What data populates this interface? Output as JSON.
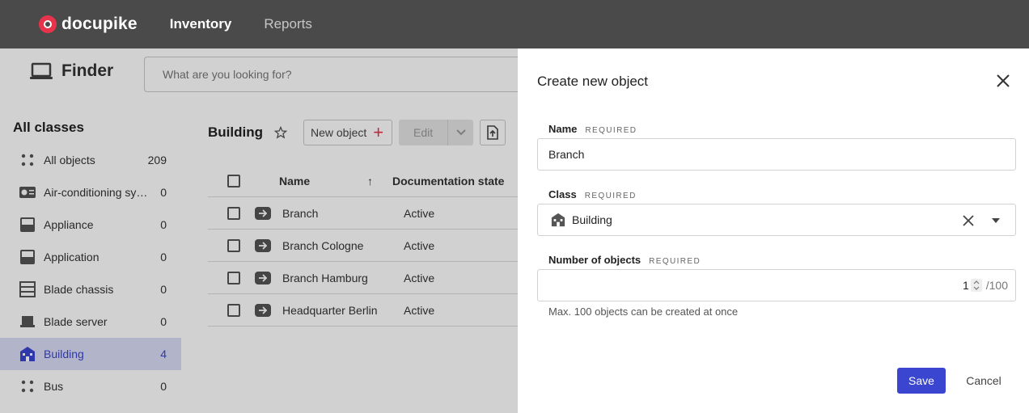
{
  "topbar": {
    "brand": "docupike",
    "nav": [
      {
        "label": "Inventory",
        "active": true
      },
      {
        "label": "Reports",
        "active": false
      }
    ]
  },
  "finder": {
    "title": "Finder",
    "search_placeholder": "What are you looking for?"
  },
  "sidebar": {
    "title": "All classes",
    "items": [
      {
        "label": "All objects",
        "count": "209",
        "icon": "dots-grid-icon"
      },
      {
        "label": "Air-conditioning system",
        "count": "0",
        "icon": "ac-unit-icon"
      },
      {
        "label": "Appliance",
        "count": "0",
        "icon": "appliance-icon"
      },
      {
        "label": "Application",
        "count": "0",
        "icon": "application-icon"
      },
      {
        "label": "Blade chassis",
        "count": "0",
        "icon": "blade-chassis-icon"
      },
      {
        "label": "Blade server",
        "count": "0",
        "icon": "blade-server-icon"
      },
      {
        "label": "Building",
        "count": "4",
        "icon": "building-icon",
        "selected": true
      },
      {
        "label": "Bus",
        "count": "0",
        "icon": "dots-grid-icon"
      }
    ]
  },
  "content": {
    "class_title": "Building",
    "new_object_label": "New object",
    "edit_label": "Edit",
    "table": {
      "headers": {
        "name": "Name",
        "state": "Documentation state"
      },
      "rows": [
        {
          "name": "Branch",
          "state": "Active"
        },
        {
          "name": "Branch Cologne",
          "state": "Active"
        },
        {
          "name": "Branch Hamburg",
          "state": "Active"
        },
        {
          "name": "Headquarter Berlin",
          "state": "Active"
        }
      ]
    }
  },
  "drawer": {
    "title": "Create new object",
    "required_tag": "REQUIRED",
    "name_label": "Name",
    "name_value": "Branch",
    "class_label": "Class",
    "class_value": "Building",
    "count_label": "Number of objects",
    "count_value": "1",
    "count_max": "/100",
    "hint": "Max. 100 objects can be created at once",
    "save_label": "Save",
    "cancel_label": "Cancel"
  },
  "colors": {
    "accent": "#3a45d0",
    "brand_red": "#e8344a",
    "topbar_bg": "#4a4a4a",
    "selected_bg": "#d9dcf6"
  }
}
